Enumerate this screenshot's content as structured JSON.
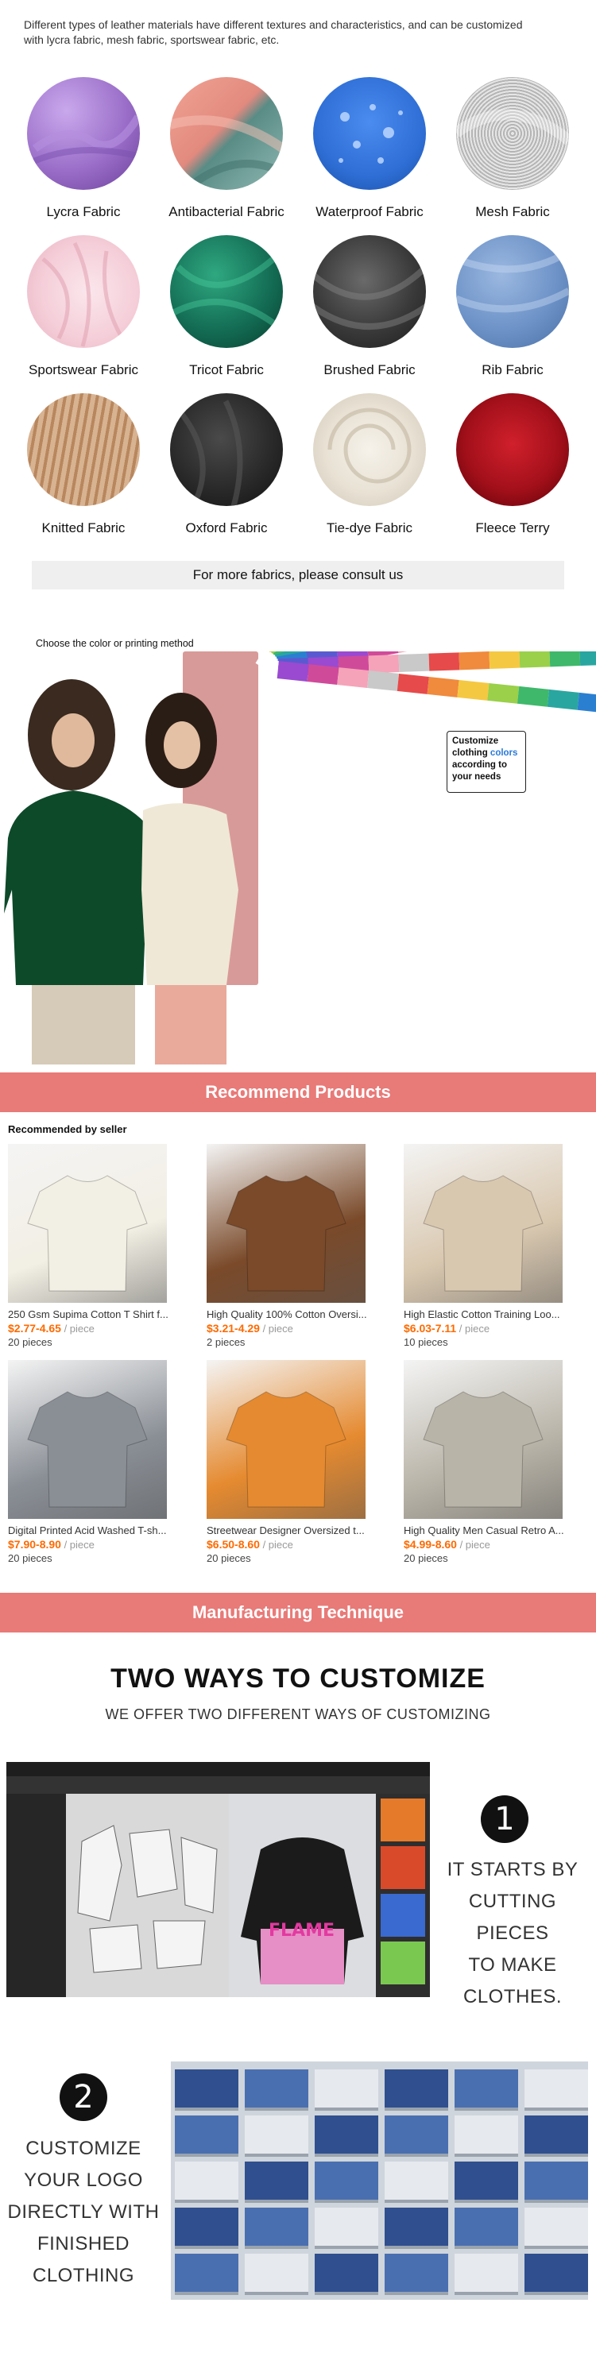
{
  "intro_text": "Different types of leather materials have different textures and characteristics, and can be customized with lycra fabric, mesh fabric, sportswear fabric, etc.",
  "fabrics": [
    {
      "label": "Lycra Fabric",
      "color": "#9b6fc9"
    },
    {
      "label": "Antibacterial Fabric",
      "color": "#e28a7e"
    },
    {
      "label": "Waterproof Fabric",
      "color": "#2f6fd6"
    },
    {
      "label": "Mesh Fabric",
      "color": "#c9c9c9"
    },
    {
      "label": "Sportswear Fabric",
      "color": "#f5cfd9"
    },
    {
      "label": "Tricot Fabric",
      "color": "#146e55"
    },
    {
      "label": "Brushed Fabric",
      "color": "#3a3a3a"
    },
    {
      "label": "Rib Fabric",
      "color": "#6e93c8"
    },
    {
      "label": "Knitted Fabric",
      "color": "#c49a74"
    },
    {
      "label": "Oxford Fabric",
      "color": "#2a2a2a"
    },
    {
      "label": "Tie-dye Fabric",
      "color": "#e8e1d4"
    },
    {
      "label": "Fleece Terry",
      "color": "#a3101a"
    }
  ],
  "consult_text": "For more fabrics, please consult us",
  "choose_label": "Choose the color or printing method",
  "customize_note": {
    "line1": "Customize",
    "line2a": "clothing ",
    "line2b": "colors",
    "line3": "according to",
    "line4": "your needs"
  },
  "recommend_title": "Recommend Products",
  "recommended_by": "Recommended by seller",
  "products": [
    {
      "name": "250 Gsm Supima Cotton T Shirt f...",
      "price": "$2.77-4.65",
      "unit": " / piece",
      "moq": "20 pieces",
      "color": "#f2efe4"
    },
    {
      "name": "High Quality 100% Cotton Oversi...",
      "price": "$3.21-4.29",
      "unit": " / piece",
      "moq": "2 pieces",
      "color": "#7a4a2a"
    },
    {
      "name": "High Elastic Cotton Training Loo...",
      "price": "$6.03-7.11",
      "unit": " / piece",
      "moq": "10 pieces",
      "color": "#d9c8b0"
    },
    {
      "name": "Digital Printed Acid Washed T-sh...",
      "price": "$7.90-8.90",
      "unit": " / piece",
      "moq": "20 pieces",
      "color": "#8a8f96"
    },
    {
      "name": "Streetwear Designer Oversized t...",
      "price": "$6.50-8.60",
      "unit": " / piece",
      "moq": "20 pieces",
      "color": "#e58a30"
    },
    {
      "name": "High Quality Men Casual Retro A...",
      "price": "$4.99-8.60",
      "unit": " / piece",
      "moq": "20 pieces",
      "color": "#b9b4a8"
    }
  ],
  "manufacturing_title": "Manufacturing Technique",
  "two_ways_title": "TWO WAYS TO CUSTOMIZE",
  "two_ways_sub": "WE OFFER TWO DIFFERENT WAYS OF CUSTOMIZING",
  "step1": {
    "num": "1",
    "lines": [
      "IT STARTS BY",
      "CUTTING PIECES",
      "TO MAKE",
      "CLOTHES."
    ]
  },
  "step2": {
    "num": "2",
    "lines": [
      "CUSTOMIZE",
      "YOUR LOGO",
      "DIRECTLY WITH",
      "FINISHED",
      "CLOTHING"
    ]
  },
  "hoodie_print": "FLAME",
  "accent": "#e87a78",
  "price_color": "#ff6a00"
}
